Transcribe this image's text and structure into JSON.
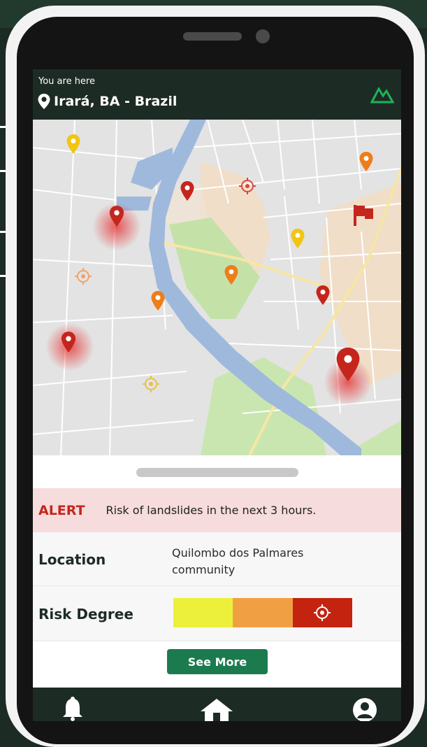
{
  "header": {
    "here_label": "You are here",
    "location": "Irará, BA - Brazil",
    "logo_icon": "mountain-icon",
    "logo_color": "#1db35a"
  },
  "map": {
    "icons": [
      "map-pin-icon",
      "target-icon",
      "flag-icon"
    ],
    "pin_colors": {
      "red": "#c4261d",
      "orange": "#ef7d1a",
      "yellow": "#f2c511"
    }
  },
  "alert": {
    "label": "ALERT",
    "message": "Risk of landslides in the next 3 hours."
  },
  "location": {
    "label": "Location",
    "value": "Quilombo dos Palmares community"
  },
  "risk": {
    "label": "Risk Degree",
    "levels": [
      {
        "color": "#edf03a"
      },
      {
        "color": "#f0a043"
      },
      {
        "color": "#c4230f",
        "selected": true
      }
    ],
    "marker_icon": "target-icon"
  },
  "see_more_label": "See More",
  "bottom_nav": {
    "items": [
      "bell-icon",
      "home-icon",
      "user-icon"
    ]
  }
}
